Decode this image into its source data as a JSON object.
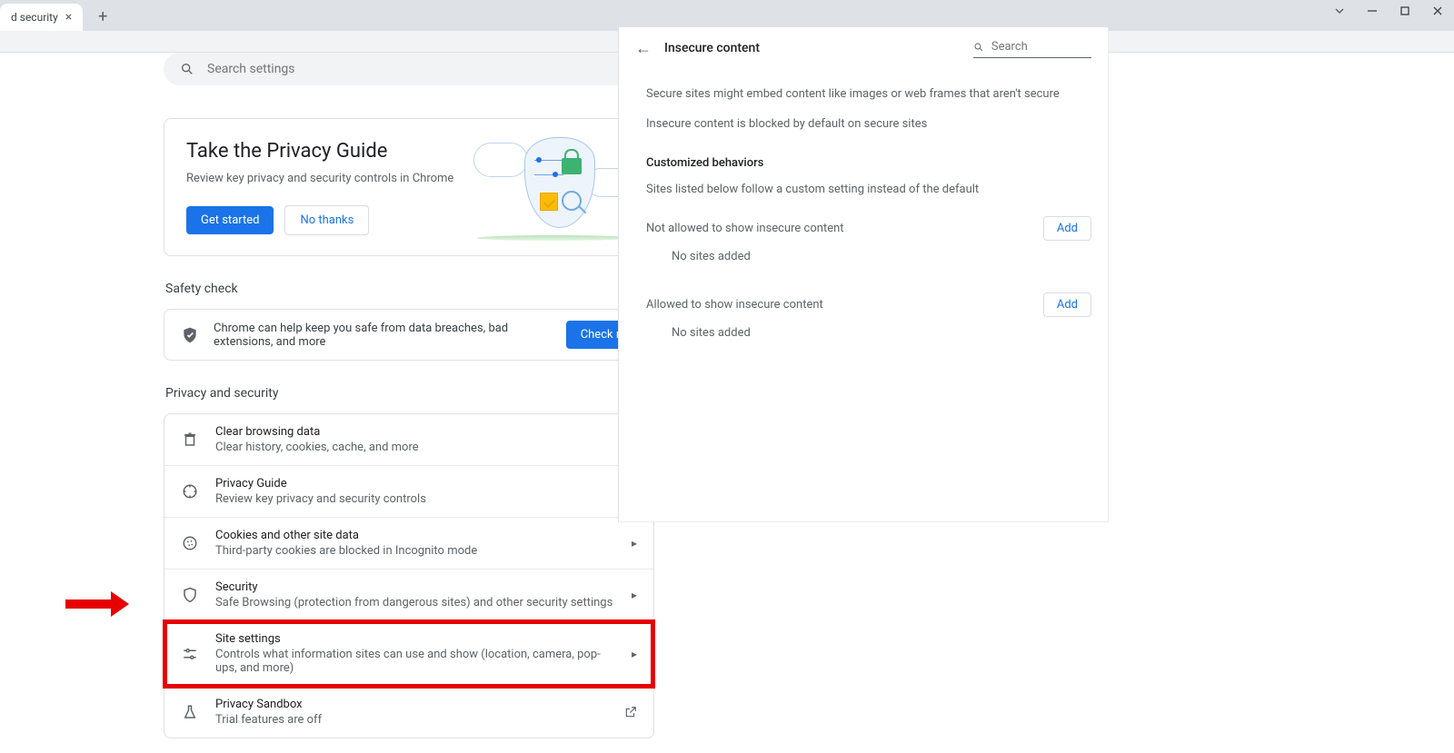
{
  "titlebar": {
    "tab_label": "d security"
  },
  "search": {
    "placeholder": "Search settings"
  },
  "guide": {
    "title": "Take the Privacy Guide",
    "subtitle": "Review key privacy and security controls in Chrome",
    "get_started": "Get started",
    "no_thanks": "No thanks"
  },
  "safety": {
    "heading": "Safety check",
    "text": "Chrome can help keep you safe from data breaches, bad extensions, and more",
    "button": "Check n"
  },
  "privacy": {
    "heading": "Privacy and security",
    "rows": [
      {
        "title": "Clear browsing data",
        "sub": "Clear history, cookies, cache, and more"
      },
      {
        "title": "Privacy Guide",
        "sub": "Review key privacy and security controls"
      },
      {
        "title": "Cookies and other site data",
        "sub": "Third-party cookies are blocked in Incognito mode"
      },
      {
        "title": "Security",
        "sub": "Safe Browsing (protection from dangerous sites) and other security settings"
      },
      {
        "title": "Site settings",
        "sub": "Controls what information sites can use and show (location, camera, pop-ups, and more)"
      },
      {
        "title": "Privacy Sandbox",
        "sub": "Trial features are off"
      }
    ]
  },
  "panel": {
    "title": "Insecure content",
    "search_placeholder": "Search",
    "line1": "Secure sites might embed content like images or web frames that aren't secure",
    "line2": "Insecure content is blocked by default on secure sites",
    "custom_heading": "Customized behaviors",
    "custom_sub": "Sites listed below follow a custom setting instead of the default",
    "not_allowed": "Not allowed to show insecure content",
    "allowed": "Allowed to show insecure content",
    "add": "Add",
    "empty": "No sites added"
  }
}
